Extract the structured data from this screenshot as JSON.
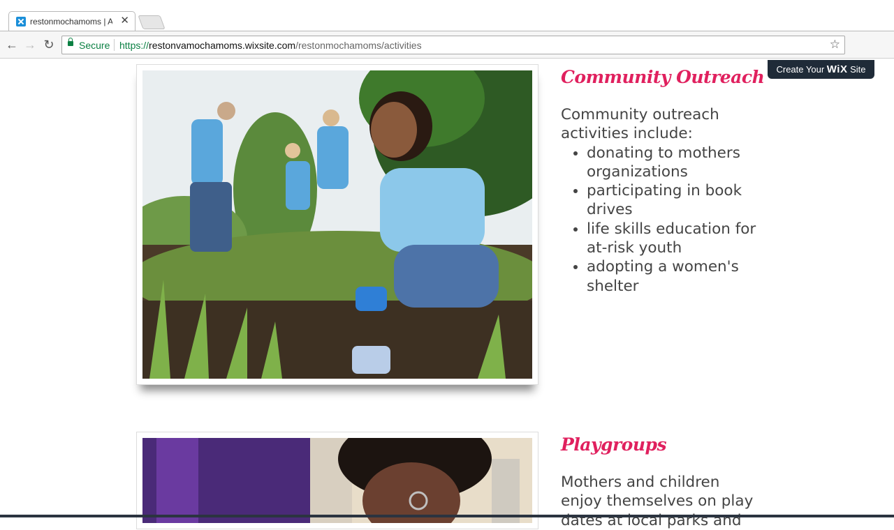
{
  "browser": {
    "tab_title": "restonmochamoms | Activities",
    "url_secure_label": "Secure",
    "url_scheme": "https://",
    "url_host": "restonvamochamoms.wixsite.com",
    "url_path": "/restonmochamoms/activities"
  },
  "wix_banner": {
    "prefix": "Create Your",
    "brand": "WiX",
    "suffix": "Site"
  },
  "sections": [
    {
      "heading": "Community Outreach",
      "intro": "Community outreach activities include:",
      "items": [
        "donating to mothers organizations",
        "participating in book drives",
        "life skills education for at-risk youth",
        "adopting a women's shelter"
      ]
    },
    {
      "heading": "Playgroups",
      "intro": "Mothers and children enjoy themselves on play dates at local parks and"
    }
  ],
  "colors": {
    "heading": "#e0205e",
    "body_text": "#444444",
    "secure_green": "#0b8043",
    "wix_button_bg": "#1f2b38"
  },
  "icons": [
    "back-arrow-icon",
    "forward-arrow-icon",
    "reload-icon",
    "lock-icon",
    "star-icon",
    "tab-close-icon",
    "wix-favicon-icon"
  ]
}
